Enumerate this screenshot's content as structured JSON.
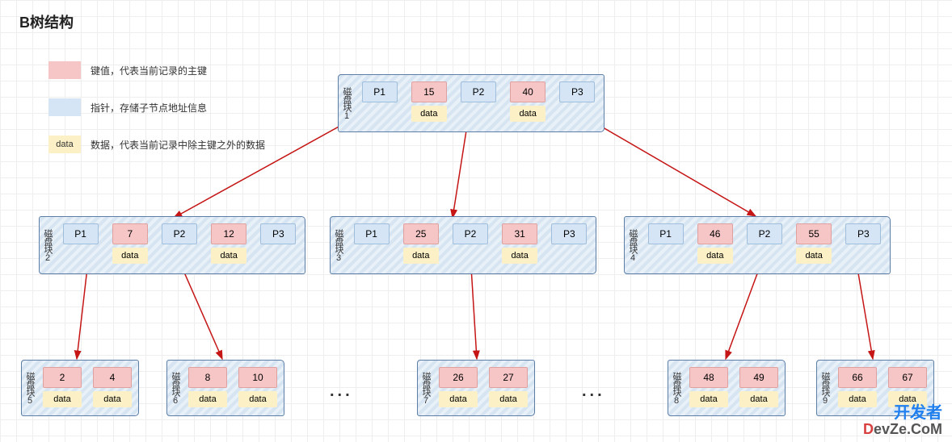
{
  "title": "B树结构",
  "legend": {
    "key_label": "键值，代表当前记录的主键",
    "ptr_label": "指针，存储子节点地址信息",
    "data_swatch_text": "data",
    "data_label": "数据，代表当前记录中除主键之外的数据"
  },
  "data_text": "data",
  "ptr": {
    "p1": "P1",
    "p2": "P2",
    "p3": "P3"
  },
  "blocks": {
    "b1": {
      "label": "磁盘块1",
      "k1": "15",
      "k2": "40"
    },
    "b2": {
      "label": "磁盘块2",
      "k1": "7",
      "k2": "12"
    },
    "b3": {
      "label": "磁盘块3",
      "k1": "25",
      "k2": "31"
    },
    "b4": {
      "label": "磁盘块4",
      "k1": "46",
      "k2": "55"
    },
    "b5": {
      "label": "磁盘块5",
      "k1": "2",
      "k2": "4"
    },
    "b6": {
      "label": "磁盘块6",
      "k1": "8",
      "k2": "10"
    },
    "b7": {
      "label": "磁盘块7",
      "k1": "26",
      "k2": "27"
    },
    "b8": {
      "label": "磁盘块8",
      "k1": "48",
      "k2": "49"
    },
    "b9": {
      "label": "磁盘块9",
      "k1": "66",
      "k2": "67"
    }
  },
  "watermark": {
    "line1": "开发者",
    "line2_red": "D",
    "line2_plain": "evZe.CoM"
  },
  "chart_data": {
    "type": "tree",
    "title": "B树结构",
    "legend": {
      "键值": "pink — 代表当前记录的主键",
      "指针": "blue — 存储子节点地址信息",
      "data": "yellow — 代表当前记录中除主键之外的数据"
    },
    "nodes": [
      {
        "id": 1,
        "label": "磁盘块1",
        "keys": [
          15,
          40
        ],
        "pointers": [
          "P1",
          "P2",
          "P3"
        ],
        "level": 0
      },
      {
        "id": 2,
        "label": "磁盘块2",
        "keys": [
          7,
          12
        ],
        "pointers": [
          "P1",
          "P2",
          "P3"
        ],
        "level": 1
      },
      {
        "id": 3,
        "label": "磁盘块3",
        "keys": [
          25,
          31
        ],
        "pointers": [
          "P1",
          "P2",
          "P3"
        ],
        "level": 1
      },
      {
        "id": 4,
        "label": "磁盘块4",
        "keys": [
          46,
          55
        ],
        "pointers": [
          "P1",
          "P2",
          "P3"
        ],
        "level": 1
      },
      {
        "id": 5,
        "label": "磁盘块5",
        "keys": [
          2,
          4
        ],
        "level": 2
      },
      {
        "id": 6,
        "label": "磁盘块6",
        "keys": [
          8,
          10
        ],
        "level": 2
      },
      {
        "id": 7,
        "label": "磁盘块7",
        "keys": [
          26,
          27
        ],
        "level": 2
      },
      {
        "id": 8,
        "label": "磁盘块8",
        "keys": [
          48,
          49
        ],
        "level": 2
      },
      {
        "id": 9,
        "label": "磁盘块9",
        "keys": [
          66,
          67
        ],
        "level": 2
      }
    ],
    "edges": [
      {
        "from": 1,
        "via": "P1",
        "to": 2
      },
      {
        "from": 1,
        "via": "P2",
        "to": 3
      },
      {
        "from": 1,
        "via": "P3",
        "to": 4
      },
      {
        "from": 2,
        "via": "P1",
        "to": 5
      },
      {
        "from": 2,
        "via": "P2",
        "to": 6
      },
      {
        "from": 4,
        "via": "P2",
        "to": 8
      },
      {
        "from": 4,
        "via": "P3",
        "to": 9
      },
      {
        "from": 3,
        "via": "P2",
        "to": 7
      }
    ],
    "ellipsis_between": [
      [
        6,
        7
      ],
      [
        7,
        8
      ]
    ]
  }
}
